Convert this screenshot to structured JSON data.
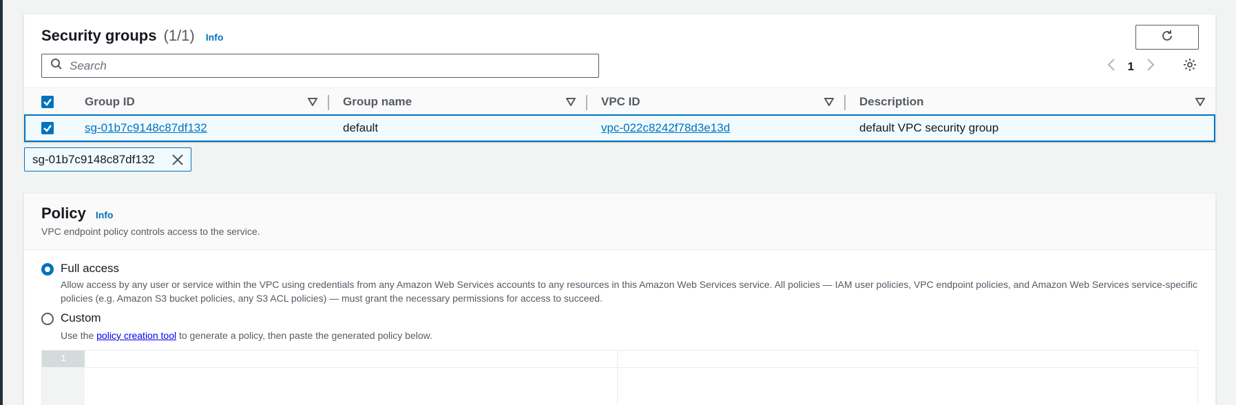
{
  "security_groups": {
    "title": "Security groups",
    "count": "(1/1)",
    "info_label": "Info",
    "search_placeholder": "Search",
    "page_number": "1",
    "columns": [
      "Group ID",
      "Group name",
      "VPC ID",
      "Description"
    ],
    "rows": [
      {
        "group_id": "sg-01b7c9148c87df132",
        "group_name": "default",
        "vpc_id": "vpc-022c8242f78d3e13d",
        "description": "default VPC security group",
        "selected": true
      }
    ],
    "selected_token": "sg-01b7c9148c87df132"
  },
  "policy": {
    "title": "Policy",
    "info_label": "Info",
    "description": "VPC endpoint policy controls access to the service.",
    "options": [
      {
        "label": "Full access",
        "selected": true,
        "description": "Allow access by any user or service within the VPC using credentials from any Amazon Web Services accounts to any resources in this Amazon Web Services service. All policies — IAM user policies, VPC endpoint policies, and Amazon Web Services service-specific policies (e.g. Amazon S3 bucket policies, any S3 ACL policies) — must grant the necessary permissions for access to succeed."
      },
      {
        "label": "Custom",
        "selected": false,
        "description_prefix": "Use the ",
        "description_link": "policy creation tool",
        "description_suffix": " to generate a policy, then paste the generated policy below."
      }
    ],
    "editor_line_number": "1"
  },
  "colors": {
    "accent": "#0073bb",
    "text": "#16191f",
    "muted": "#545b64",
    "page_bg": "#f2f3f3"
  }
}
